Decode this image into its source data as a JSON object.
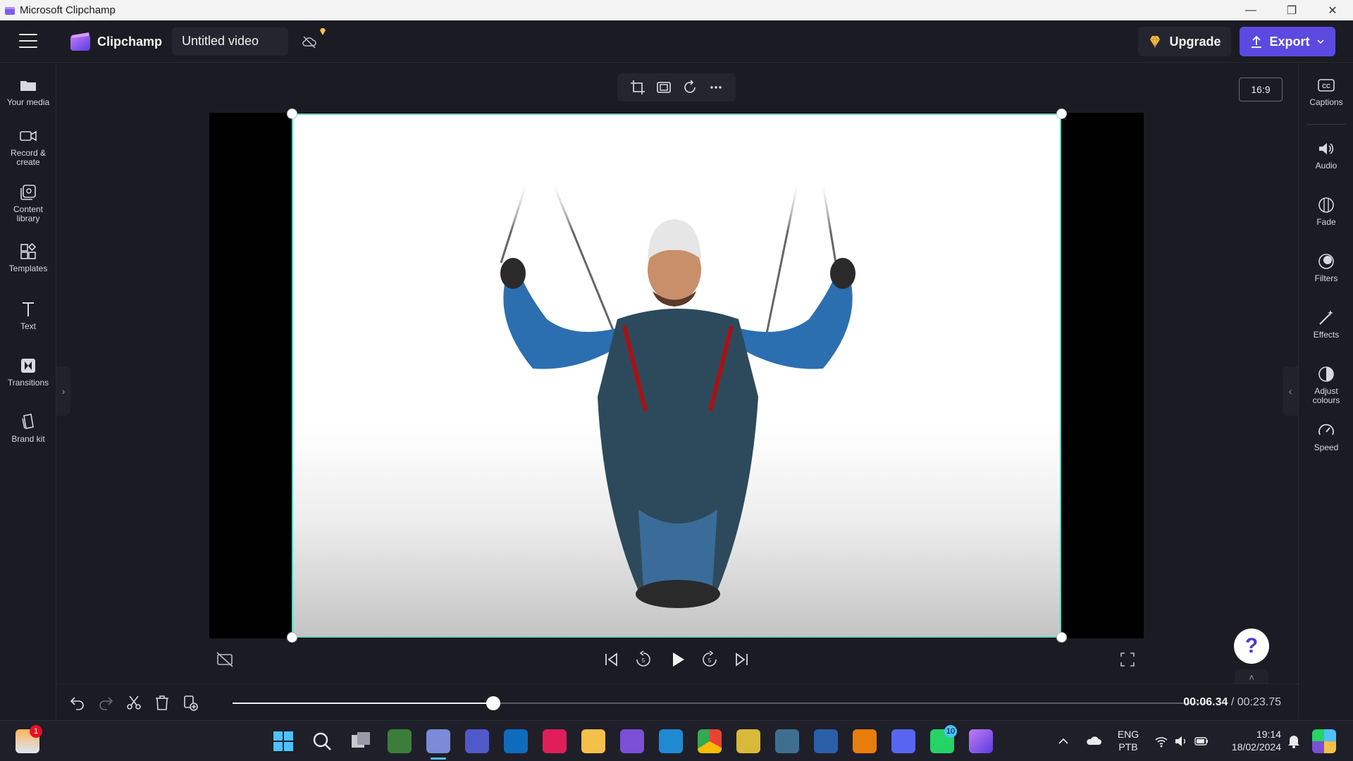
{
  "window": {
    "title": "Microsoft Clipchamp",
    "minimize": "—",
    "restore": "❐",
    "close": "✕"
  },
  "header": {
    "brand": "Clipchamp",
    "video_title": "Untitled video",
    "upgrade_label": "Upgrade",
    "export_label": "Export"
  },
  "left_nav": [
    {
      "label": "Your media",
      "icon": "folder-icon"
    },
    {
      "label": "Record &\ncreate",
      "icon": "camera-icon"
    },
    {
      "label": "Content\nlibrary",
      "icon": "library-icon"
    },
    {
      "label": "Templates",
      "icon": "templates-icon"
    },
    {
      "label": "Text",
      "icon": "text-icon"
    },
    {
      "label": "Transitions",
      "icon": "transitions-icon"
    },
    {
      "label": "Brand kit",
      "icon": "brand-kit-icon"
    }
  ],
  "right_nav": [
    {
      "label": "Captions",
      "icon": "captions-icon"
    },
    {
      "label": "Audio",
      "icon": "speaker-icon"
    },
    {
      "label": "Fade",
      "icon": "fade-icon"
    },
    {
      "label": "Filters",
      "icon": "filters-icon"
    },
    {
      "label": "Effects",
      "icon": "effects-wand-icon"
    },
    {
      "label": "Adjust\ncolours",
      "icon": "adjust-colours-icon"
    },
    {
      "label": "Speed",
      "icon": "speedometer-icon"
    }
  ],
  "stage": {
    "aspect_ratio": "16:9",
    "toolbar": [
      "crop-icon",
      "fit-icon",
      "rotate-icon",
      "more-icon"
    ]
  },
  "playback": {
    "current_time": "00:06.34",
    "separator": " / ",
    "total_time": "00:23.75",
    "progress_fraction": 0.267
  },
  "help_label": "?",
  "taskbar": {
    "weather_badge": "1",
    "whatsapp_badge": "10",
    "language_line1": "ENG",
    "language_line2": "PTB",
    "time": "19:14",
    "date": "18/02/2024"
  },
  "colors": {
    "accent": "#5b4ae0",
    "selection": "#5fd3c4",
    "background": "#1b1b23"
  }
}
